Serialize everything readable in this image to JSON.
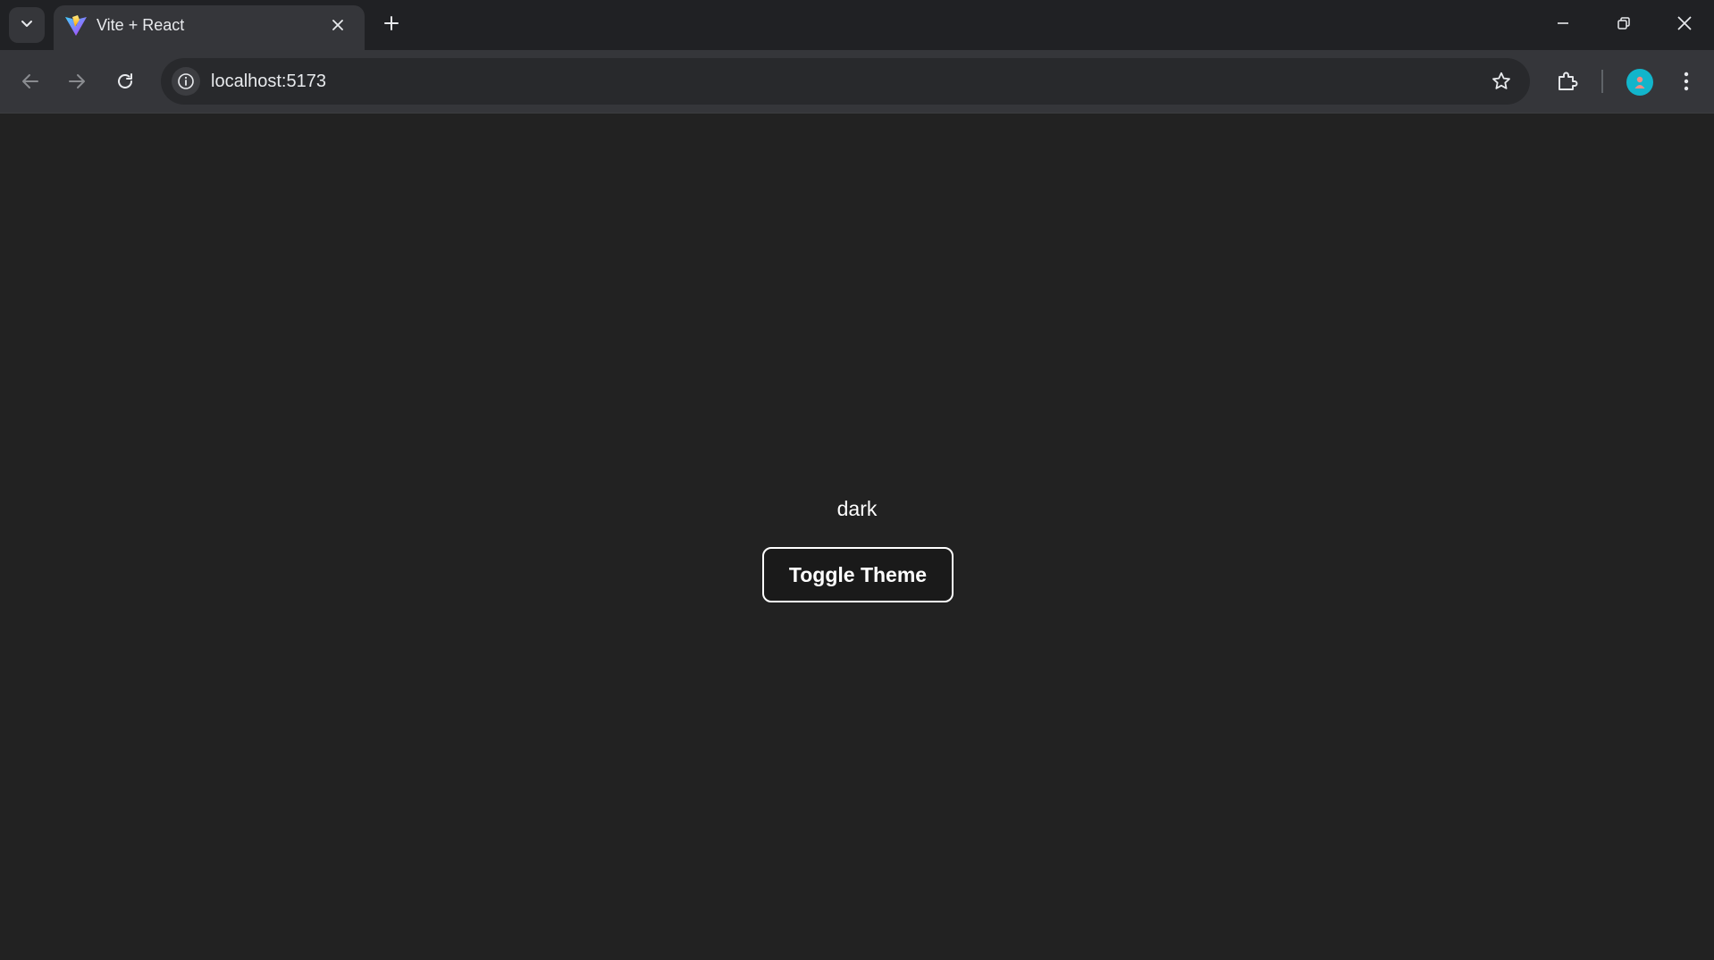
{
  "browser": {
    "tab": {
      "title": "Vite + React"
    },
    "address_bar": {
      "url": "localhost:5173"
    },
    "icons": [
      "tab-search-icon",
      "vite-logo-icon",
      "close-icon",
      "plus-icon",
      "minimize-icon",
      "restore-icon",
      "close-window-icon",
      "back-arrow-icon",
      "forward-arrow-icon",
      "reload-icon",
      "info-icon",
      "star-icon",
      "puzzle-icon",
      "avatar",
      "kebab-menu-icon"
    ]
  },
  "page": {
    "theme_label": "dark",
    "toggle_button": "Toggle Theme"
  },
  "colors": {
    "page_background": "#222222",
    "tabstrip": "#202124",
    "toolbar": "#35363a",
    "text": "#ffffff",
    "avatar": "#12b5cb"
  }
}
